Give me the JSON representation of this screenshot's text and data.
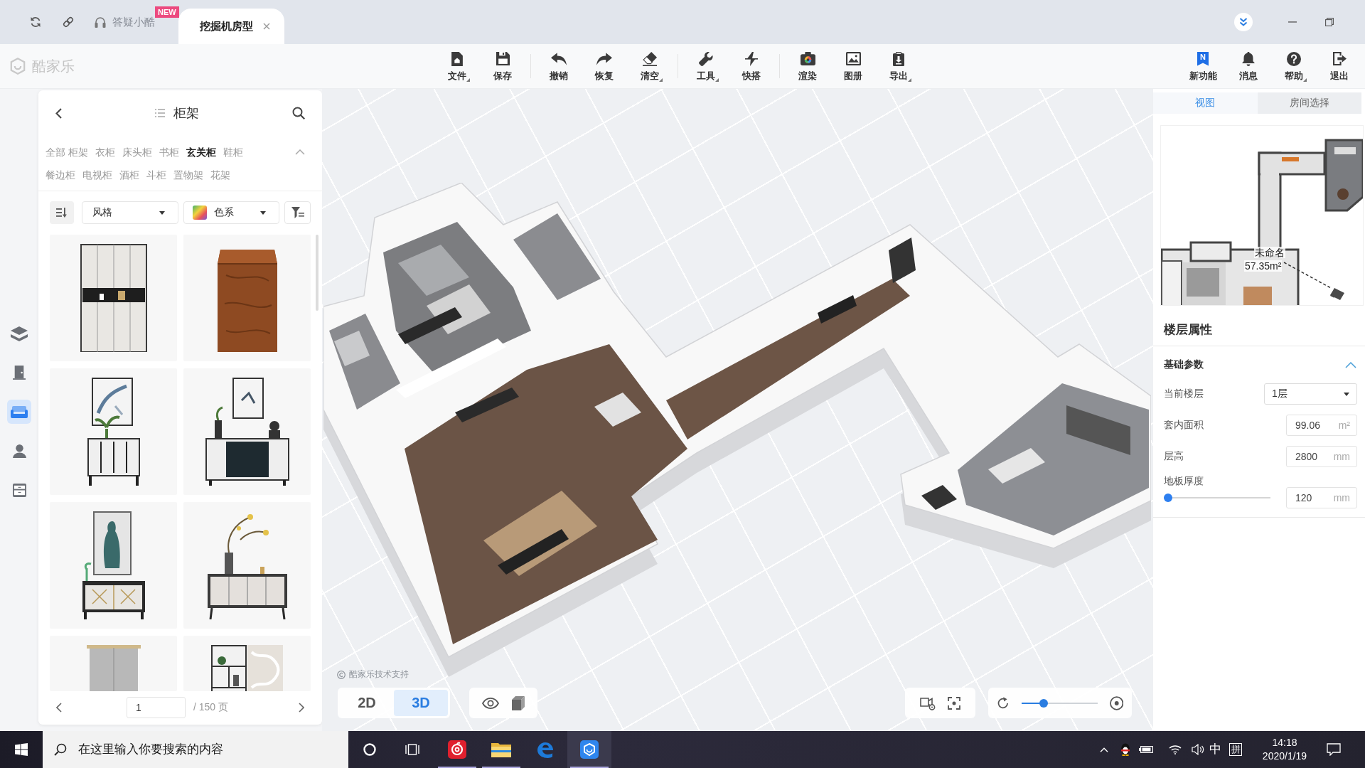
{
  "title_bar": {
    "help": {
      "label": "答疑小酷",
      "badge": "NEW"
    },
    "tabs": [
      {
        "label": "挖掘机房型",
        "selected": true
      }
    ]
  },
  "toolbar": {
    "logo": "酷家乐",
    "groups": [
      [
        {
          "kind": "file",
          "label": "文件",
          "menu": true
        },
        {
          "kind": "save",
          "label": "保存",
          "menu": false
        }
      ],
      [
        {
          "kind": "undo",
          "label": "撤销",
          "menu": false
        },
        {
          "kind": "redo",
          "label": "恢复",
          "menu": false
        },
        {
          "kind": "clear",
          "label": "清空",
          "menu": true
        }
      ],
      [
        {
          "kind": "tools",
          "label": "工具",
          "menu": true
        },
        {
          "kind": "assemble",
          "label": "快搭",
          "menu": false
        }
      ],
      [
        {
          "kind": "render",
          "label": "渲染",
          "menu": false
        },
        {
          "kind": "album",
          "label": "图册",
          "menu": false
        },
        {
          "kind": "export",
          "label": "导出",
          "menu": true
        }
      ]
    ],
    "right": [
      {
        "kind": "features",
        "label": "新功能",
        "icon_text": "N",
        "menu": false
      },
      {
        "kind": "messages",
        "label": "消息",
        "menu": false
      },
      {
        "kind": "help",
        "label": "帮助",
        "menu": true
      },
      {
        "kind": "logout",
        "label": "退出",
        "menu": false
      }
    ]
  },
  "side_rail": [
    {
      "kind": "floor",
      "selected": false
    },
    {
      "kind": "door",
      "selected": false
    },
    {
      "kind": "furniture",
      "selected": true
    },
    {
      "kind": "person",
      "selected": false
    },
    {
      "kind": "cabinet",
      "selected": false
    }
  ],
  "library": {
    "title": "柜架",
    "categories": [
      {
        "label": "全部 柜架",
        "selected": false
      },
      {
        "label": "衣柜",
        "selected": false
      },
      {
        "label": "床头柜",
        "selected": false
      },
      {
        "label": "书柜",
        "selected": false
      },
      {
        "label": "玄关柜",
        "selected": true
      },
      {
        "label": "鞋柜",
        "selected": false
      },
      {
        "label": "餐边柜",
        "selected": false
      },
      {
        "label": "电视柜",
        "selected": false
      },
      {
        "label": "酒柜",
        "selected": false
      },
      {
        "label": "斗柜",
        "selected": false
      },
      {
        "label": "置物架",
        "selected": false
      },
      {
        "label": "花架",
        "selected": false
      }
    ],
    "categories_expanded": true,
    "filters": [
      {
        "kind": "style",
        "label": "风格"
      },
      {
        "kind": "color",
        "label": "色系"
      }
    ],
    "products": [
      {
        "kind": "wardrobe"
      },
      {
        "kind": "chest"
      },
      {
        "kind": "console"
      },
      {
        "kind": "sideboard"
      },
      {
        "kind": "cabinet"
      },
      {
        "kind": "credenza"
      },
      {
        "kind": "locker"
      },
      {
        "kind": "shelf"
      }
    ],
    "pagination": {
      "page": "1",
      "total": "/ 150 页"
    }
  },
  "viewport": {
    "credit": "酷家乐技术支持",
    "view_modes": [
      {
        "label": "2D",
        "selected": false
      },
      {
        "label": "3D",
        "selected": true
      }
    ],
    "zoom": {
      "level": 0.27
    }
  },
  "right_panel": {
    "tabs": [
      {
        "label": "视图",
        "selected": true
      },
      {
        "label": "房间选择",
        "selected": false
      }
    ],
    "minimap": {
      "room_name": "未命名",
      "room_area": "57.35m²"
    },
    "title": "楼层属性",
    "section": {
      "title": "基础参数",
      "expanded": true,
      "fields": [
        {
          "kind": "select",
          "label": "当前楼层",
          "value": "1层"
        },
        {
          "kind": "number",
          "label": "套内面积",
          "value": "99.06",
          "unit": "m²"
        },
        {
          "kind": "number",
          "label": "层高",
          "value": "2800",
          "unit": "mm"
        },
        {
          "kind": "slider",
          "label": "地板厚度",
          "level": 0,
          "value": "120",
          "unit": "mm"
        }
      ]
    }
  },
  "taskbar": {
    "search": {
      "placeholder": "在这里输入你要搜索的内容"
    },
    "apps": [
      {
        "kind": "music",
        "running": true,
        "active": false
      },
      {
        "kind": "folder",
        "running": true,
        "active": false
      },
      {
        "kind": "browser",
        "running": false,
        "active": false
      },
      {
        "kind": "design",
        "running": true,
        "active": true
      }
    ],
    "ime_mode": "中",
    "ime": "拼",
    "time": "14:18",
    "date": "2020/1/19"
  }
}
